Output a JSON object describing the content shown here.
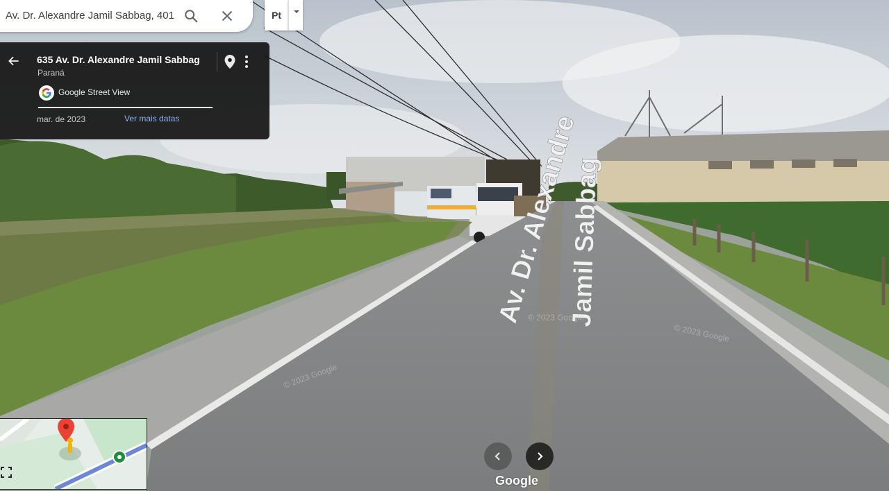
{
  "search": {
    "value": "Av. Dr. Alexandre Jamil Sabbag, 401"
  },
  "layer_button": {
    "label": "Pt"
  },
  "info_panel": {
    "title": "635 Av. Dr. Alexandre Jamil Sabbag",
    "region": "Paraná",
    "provider": "Google Street View",
    "date": "mar. de 2023",
    "more_dates_link": "Ver mais datas"
  },
  "street_labels": {
    "line1": "Av. Dr. Alexandre",
    "line2": "Jamil Sabbag"
  },
  "watermarks": [
    "© 2023 Google",
    "© 2023 Google",
    "© 2023 Google"
  ],
  "footer": {
    "logo": "Google"
  },
  "icons": [
    "search-icon",
    "close-icon",
    "back-icon",
    "pin-icon",
    "more-vert-icon",
    "google-g-icon",
    "chevron-left-icon",
    "chevron-right-icon",
    "expand-icon",
    "pegman-icon"
  ],
  "colors": {
    "link": "#8ab4f8",
    "panel_bg": "#141414",
    "map_route": "#5b7bd8",
    "pin": "#ea4335",
    "marker": "#1e8e3e"
  }
}
